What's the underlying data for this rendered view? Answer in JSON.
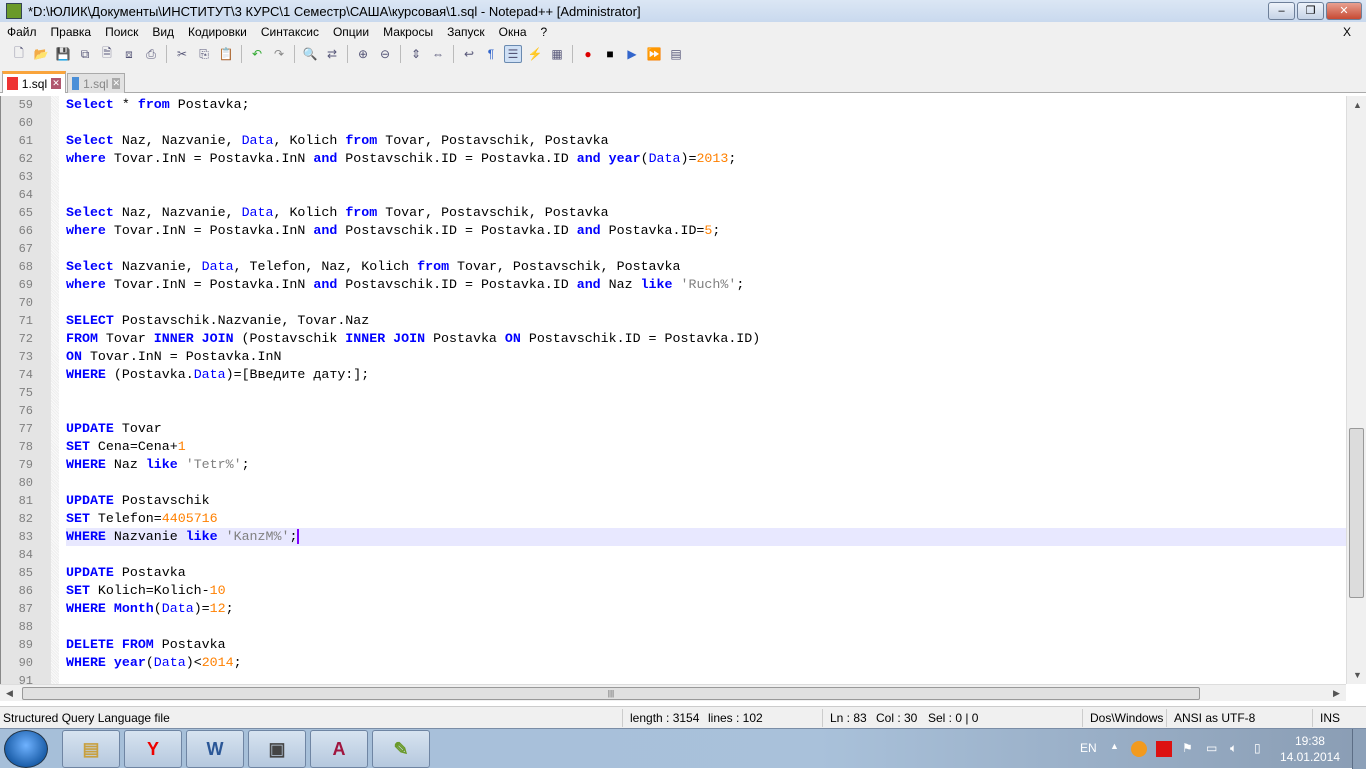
{
  "window": {
    "title": "*D:\\ЮЛИК\\Документы\\ИНСТИТУТ\\3 КУРС\\1 Семестр\\САША\\курсовая\\1.sql - Notepad++ [Administrator]",
    "min": "–",
    "max": "❐",
    "close": "✕"
  },
  "menu": [
    "Файл",
    "Правка",
    "Поиск",
    "Вид",
    "Кодировки",
    "Синтаксис",
    "Опции",
    "Макросы",
    "Запуск",
    "Окна",
    "?"
  ],
  "menu_close": "X",
  "toolbar": [
    "new",
    "open",
    "save",
    "save-all",
    "close",
    "close-all",
    "print",
    "|",
    "cut",
    "copy",
    "paste",
    "|",
    "undo",
    "redo",
    "|",
    "find",
    "replace",
    "|",
    "zoom-in",
    "zoom-out",
    "|",
    "sync-v",
    "sync-h",
    "|",
    "word-wrap",
    "show-all",
    "indent-guide",
    "udl",
    "doc-map",
    "|",
    "record",
    "stop",
    "play",
    "play-multiple",
    "save-macro"
  ],
  "tabs": [
    {
      "label": "1.sql",
      "active": true
    },
    {
      "label": "1.sql",
      "active": false
    }
  ],
  "editor": {
    "current_line": 83,
    "lines": [
      {
        "n": "59",
        "t": [
          [
            "k",
            "Select"
          ],
          [
            "t",
            " * "
          ],
          [
            "k",
            "from"
          ],
          [
            "t",
            " Postavka;"
          ]
        ]
      },
      {
        "n": "60",
        "t": []
      },
      {
        "n": "61",
        "t": [
          [
            "k",
            "Select"
          ],
          [
            "t",
            " Naz, Nazvanie, "
          ],
          [
            "f",
            "Data"
          ],
          [
            "t",
            ", Kolich "
          ],
          [
            "k",
            "from"
          ],
          [
            "t",
            " Tovar, Postavschik, Postavka"
          ]
        ]
      },
      {
        "n": "62",
        "t": [
          [
            "k",
            "where"
          ],
          [
            "t",
            " Tovar.InN = Postavka.InN "
          ],
          [
            "k",
            "and"
          ],
          [
            "t",
            " Postavschik.ID = Postavka.ID "
          ],
          [
            "k",
            "and"
          ],
          [
            "t",
            " "
          ],
          [
            "k",
            "year"
          ],
          [
            "t",
            "("
          ],
          [
            "f",
            "Data"
          ],
          [
            "t",
            ")="
          ],
          [
            "n",
            "2013"
          ],
          [
            "t",
            ";"
          ]
        ]
      },
      {
        "n": "63",
        "t": []
      },
      {
        "n": "64",
        "t": []
      },
      {
        "n": "65",
        "t": [
          [
            "k",
            "Select"
          ],
          [
            "t",
            " Naz, Nazvanie, "
          ],
          [
            "f",
            "Data"
          ],
          [
            "t",
            ", Kolich "
          ],
          [
            "k",
            "from"
          ],
          [
            "t",
            " Tovar, Postavschik, Postavka"
          ]
        ]
      },
      {
        "n": "66",
        "t": [
          [
            "k",
            "where"
          ],
          [
            "t",
            " Tovar.InN = Postavka.InN "
          ],
          [
            "k",
            "and"
          ],
          [
            "t",
            " Postavschik.ID = Postavka.ID "
          ],
          [
            "k",
            "and"
          ],
          [
            "t",
            " Postavka.ID="
          ],
          [
            "n",
            "5"
          ],
          [
            "t",
            ";"
          ]
        ]
      },
      {
        "n": "67",
        "t": []
      },
      {
        "n": "68",
        "t": [
          [
            "k",
            "Select"
          ],
          [
            "t",
            " Nazvanie, "
          ],
          [
            "f",
            "Data"
          ],
          [
            "t",
            ", Telefon, Naz, Kolich "
          ],
          [
            "k",
            "from"
          ],
          [
            "t",
            " Tovar, Postavschik, Postavka"
          ]
        ]
      },
      {
        "n": "69",
        "t": [
          [
            "k",
            "where"
          ],
          [
            "t",
            " Tovar.InN = Postavka.InN "
          ],
          [
            "k",
            "and"
          ],
          [
            "t",
            " Postavschik.ID = Postavka.ID "
          ],
          [
            "k",
            "and"
          ],
          [
            "t",
            " Naz "
          ],
          [
            "k",
            "like"
          ],
          [
            "t",
            " "
          ],
          [
            "s",
            "'Ruch%'"
          ],
          [
            "t",
            ";"
          ]
        ]
      },
      {
        "n": "70",
        "t": []
      },
      {
        "n": "71",
        "t": [
          [
            "k",
            "SELECT"
          ],
          [
            "t",
            " Postavschik.Nazvanie, Tovar.Naz"
          ]
        ]
      },
      {
        "n": "72",
        "t": [
          [
            "k",
            "FROM"
          ],
          [
            "t",
            " Tovar "
          ],
          [
            "k",
            "INNER JOIN"
          ],
          [
            "t",
            " (Postavschik "
          ],
          [
            "k",
            "INNER JOIN"
          ],
          [
            "t",
            " Postavka "
          ],
          [
            "k",
            "ON"
          ],
          [
            "t",
            " Postavschik.ID = Postavka.ID)"
          ]
        ]
      },
      {
        "n": "73",
        "t": [
          [
            "k",
            "ON"
          ],
          [
            "t",
            " Tovar.InN = Postavka.InN"
          ]
        ]
      },
      {
        "n": "74",
        "t": [
          [
            "k",
            "WHERE"
          ],
          [
            "t",
            " (Postavka."
          ],
          [
            "f",
            "Data"
          ],
          [
            "t",
            ")=[Введите дату:];"
          ]
        ]
      },
      {
        "n": "75",
        "t": []
      },
      {
        "n": "76",
        "t": []
      },
      {
        "n": "77",
        "t": [
          [
            "k",
            "UPDATE"
          ],
          [
            "t",
            " Tovar"
          ]
        ]
      },
      {
        "n": "78",
        "t": [
          [
            "k",
            "SET"
          ],
          [
            "t",
            " Cena=Cena+"
          ],
          [
            "n",
            "1"
          ]
        ]
      },
      {
        "n": "79",
        "t": [
          [
            "k",
            "WHERE"
          ],
          [
            "t",
            " Naz "
          ],
          [
            "k",
            "like"
          ],
          [
            "t",
            " "
          ],
          [
            "s",
            "'Tetr%'"
          ],
          [
            "t",
            ";"
          ]
        ]
      },
      {
        "n": "80",
        "t": []
      },
      {
        "n": "81",
        "t": [
          [
            "k",
            "UPDATE"
          ],
          [
            "t",
            " Postavschik"
          ]
        ]
      },
      {
        "n": "82",
        "t": [
          [
            "k",
            "SET"
          ],
          [
            "t",
            " Telefon="
          ],
          [
            "n",
            "4405716"
          ]
        ]
      },
      {
        "n": "83",
        "t": [
          [
            "k",
            "WHERE"
          ],
          [
            "t",
            " Nazvanie "
          ],
          [
            "k",
            "like"
          ],
          [
            "t",
            " "
          ],
          [
            "s",
            "'KanzM%'"
          ],
          [
            "t",
            ";"
          ]
        ]
      },
      {
        "n": "84",
        "t": []
      },
      {
        "n": "85",
        "t": [
          [
            "k",
            "UPDATE"
          ],
          [
            "t",
            " Postavka"
          ]
        ]
      },
      {
        "n": "86",
        "t": [
          [
            "k",
            "SET"
          ],
          [
            "t",
            " Kolich=Kolich-"
          ],
          [
            "n",
            "10"
          ]
        ]
      },
      {
        "n": "87",
        "t": [
          [
            "k",
            "WHERE"
          ],
          [
            "t",
            " "
          ],
          [
            "k",
            "Month"
          ],
          [
            "t",
            "("
          ],
          [
            "f",
            "Data"
          ],
          [
            "t",
            ")="
          ],
          [
            "n",
            "12"
          ],
          [
            "t",
            ";"
          ]
        ]
      },
      {
        "n": "88",
        "t": []
      },
      {
        "n": "89",
        "t": [
          [
            "k",
            "DELETE FROM"
          ],
          [
            "t",
            " Postavka"
          ]
        ]
      },
      {
        "n": "90",
        "t": [
          [
            "k",
            "WHERE"
          ],
          [
            "t",
            " "
          ],
          [
            "k",
            "year"
          ],
          [
            "t",
            "("
          ],
          [
            "f",
            "Data"
          ],
          [
            "t",
            ")<"
          ],
          [
            "n",
            "2014"
          ],
          [
            "t",
            ";"
          ]
        ]
      },
      {
        "n": "91",
        "t": []
      }
    ]
  },
  "status": {
    "filetype": "Structured Query Language file",
    "length": "length : 3154",
    "lines": "lines : 102",
    "ln": "Ln : 83",
    "col": "Col : 30",
    "sel": "Sel : 0 | 0",
    "eol": "Dos\\Windows",
    "encoding": "ANSI as UTF-8",
    "mode": "INS"
  },
  "taskbar": {
    "apps": [
      "explorer",
      "yandex-browser",
      "word",
      "file-manager",
      "access",
      "notepad-plus-plus"
    ],
    "lang": "EN",
    "time": "19:38",
    "date": "14.01.2014"
  },
  "colors": {
    "keyword": "#0000ff",
    "number": "#ff8000",
    "string": "#808080",
    "current_line": "#e8e8ff"
  }
}
